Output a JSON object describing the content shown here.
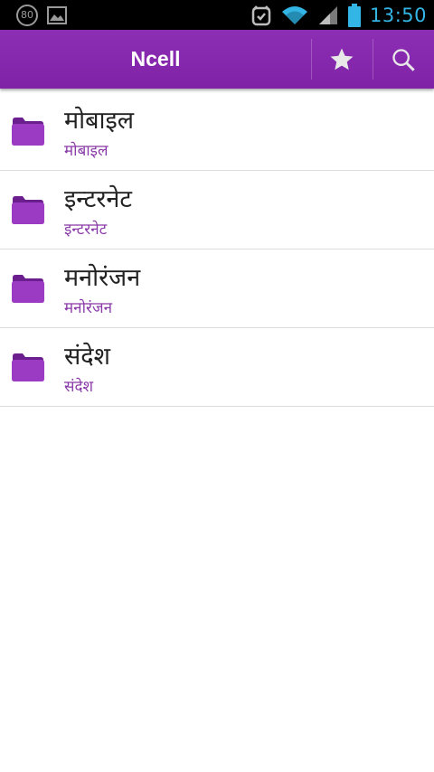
{
  "status_bar": {
    "notification_count": "80",
    "time": "13:50"
  },
  "action_bar": {
    "title": "Ncell",
    "color": "#8a2cb2"
  },
  "categories": [
    {
      "title": "मोबाइल",
      "subtitle": "मोबाइल"
    },
    {
      "title": "इन्टरनेट",
      "subtitle": "इन्टरनेट"
    },
    {
      "title": "मनोरंजन",
      "subtitle": "मनोरंजन"
    },
    {
      "title": "संदेश",
      "subtitle": "संदेश"
    }
  ],
  "icons": {
    "favorite": "star-icon",
    "search": "search-icon",
    "item": "folder-icon"
  }
}
